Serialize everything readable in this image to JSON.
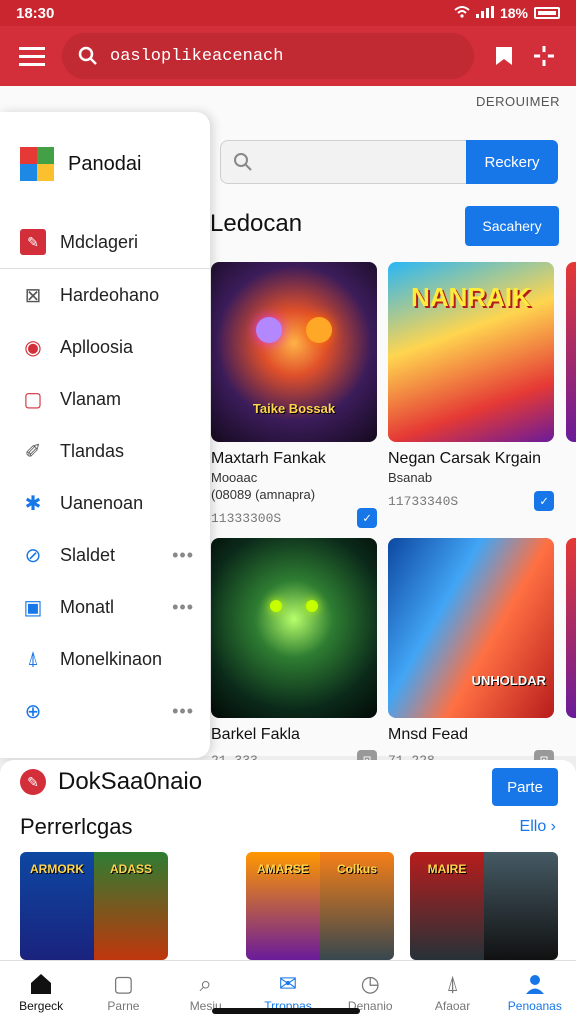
{
  "status_bar": {
    "time": "18:30",
    "battery": "18%"
  },
  "app_bar": {
    "search_text": "oasloplikeacenach"
  },
  "subheader": "DEROUIMER",
  "search": {
    "button": "Reckery"
  },
  "section": {
    "title": "Ledocan",
    "button": "Sacahery"
  },
  "cards": [
    {
      "name": "Maxtarh Fankak",
      "sub1": "Mooaac",
      "sub2": "(08089 (amnapra)",
      "count": "11333300S",
      "art_text": "Taike Bossak"
    },
    {
      "name": "Negan Carsak Krgain",
      "sub1": "Bsanab",
      "sub2": "",
      "count": "11733340S",
      "art_text": "NANRAIK"
    },
    {
      "name": "Barkel Fakla",
      "sub1": "",
      "sub2": "",
      "count": "21.333",
      "art_text": ""
    },
    {
      "name": "Mnsd Fead",
      "sub1": "",
      "sub2": "",
      "count": "71.228",
      "art_text": "UNHOLDAR"
    }
  ],
  "drawer": {
    "title": "Panodai",
    "items": [
      {
        "label": "Mdclageri",
        "icon": "tag-icon"
      },
      {
        "label": "Hardeohano",
        "icon": "map-icon"
      },
      {
        "label": "Aplloosia",
        "icon": "record-icon"
      },
      {
        "label": "Vlanam",
        "icon": "bookmark-icon"
      },
      {
        "label": "Tlandas",
        "icon": "pencil-icon"
      },
      {
        "label": "Uanenoan",
        "icon": "star-icon"
      },
      {
        "label": "Slaldet",
        "icon": "brush-icon"
      },
      {
        "label": "Monatl",
        "icon": "frame-icon"
      },
      {
        "label": "Monelkinaon",
        "icon": "bell-icon"
      },
      {
        "label": "",
        "icon": "search-icon"
      }
    ]
  },
  "bottom": {
    "title": "DokSaa0naio",
    "button": "Parte",
    "subtitle": "Perrerlcgas",
    "link": "Ello",
    "thumbs": [
      {
        "left": "ARMORK",
        "right": "ADASS"
      },
      {
        "left": "AMARSE",
        "right": "Colkus"
      },
      {
        "left": "MAIRE",
        "right": ""
      }
    ]
  },
  "nav": [
    {
      "label": "Bergeck",
      "icon": "home-icon"
    },
    {
      "label": "Parne",
      "icon": "frame-icon"
    },
    {
      "label": "Mesiu",
      "icon": "search-icon"
    },
    {
      "label": "Trroppas",
      "icon": "mail-icon"
    },
    {
      "label": "Denanio",
      "icon": "clock-icon"
    },
    {
      "label": "Afaoar",
      "icon": "bell-icon"
    },
    {
      "label": "Penoanas",
      "icon": "person-icon"
    }
  ],
  "colors": {
    "brand": "#d32f3a",
    "accent": "#1877e8"
  }
}
